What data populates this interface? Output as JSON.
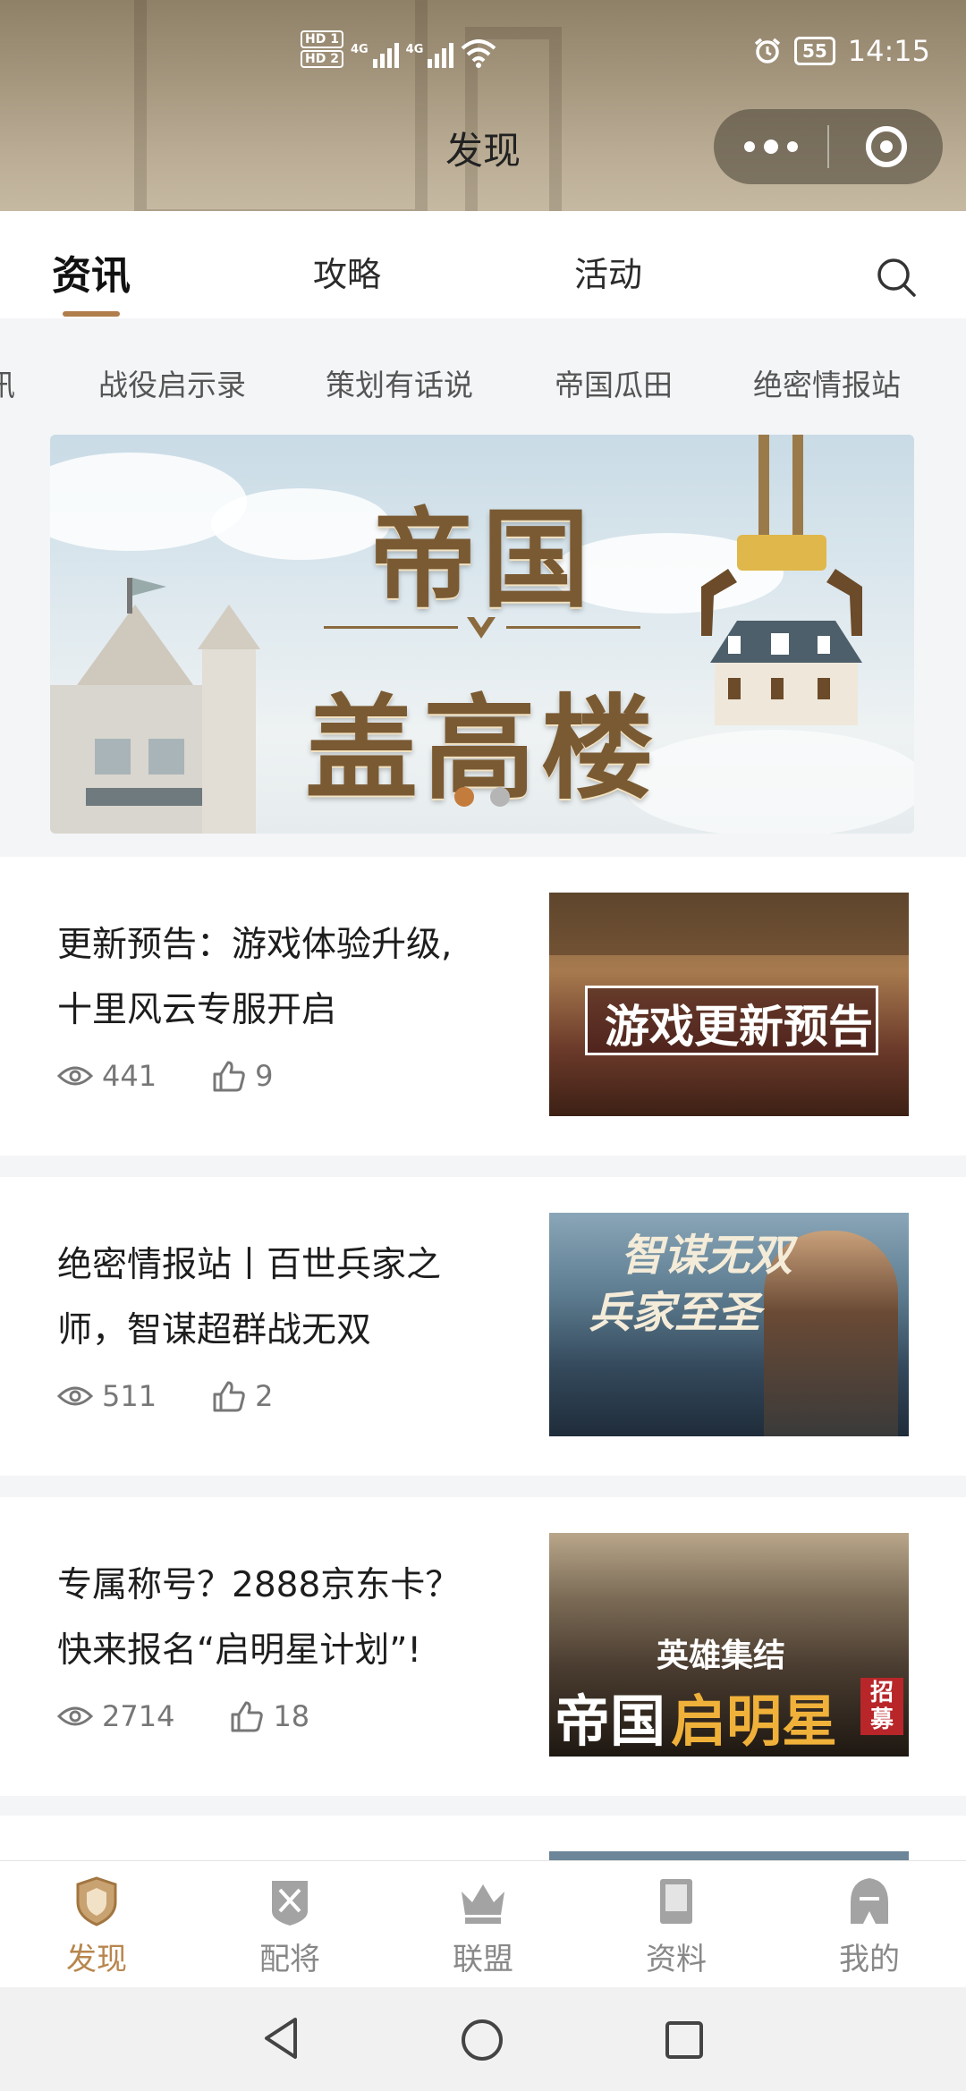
{
  "status_bar": {
    "hd1": "HD 1",
    "hd2": "HD 2",
    "sim1": "4G",
    "sim2": "4G",
    "battery": "55",
    "time": "14:15"
  },
  "header": {
    "title": "发现"
  },
  "main_tabs": [
    "资讯",
    "攻略",
    "活动"
  ],
  "sub_tabs": [
    "讯",
    "战役启示录",
    "策划有话说",
    "帝国瓜田",
    "绝密情报站"
  ],
  "banner": {
    "line1": "帝国",
    "line2": "盖高楼",
    "slide_count": 2,
    "active_slide": 1
  },
  "articles": [
    {
      "title_line1": "更新预告：游戏体验升级,",
      "title_line2": "十里风云专服开启",
      "views": "441",
      "likes": "9",
      "thumb_text": "游戏更新预告"
    },
    {
      "title_line1": "绝密情报站丨百世兵家之",
      "title_line2": "师，智谋超群战无双",
      "views": "511",
      "likes": "2",
      "thumb_text_1": "智谋无双",
      "thumb_text_2": "兵家至圣"
    },
    {
      "title_line1": "专属称号？2888京东卡？",
      "title_line2": "快来报名“启明星计划”!",
      "views": "2714",
      "likes": "18",
      "thumb_text_1": "英雄集结",
      "thumb_text_2": "帝国",
      "thumb_text_3": "启明星",
      "thumb_text_4": "招募"
    }
  ],
  "bottom_nav": [
    "发现",
    "配将",
    "联盟",
    "资料",
    "我的"
  ],
  "colors": {
    "accent": "#b8864e",
    "tab_underline": "#b07d4c",
    "dot_active": "#c47c3c"
  }
}
